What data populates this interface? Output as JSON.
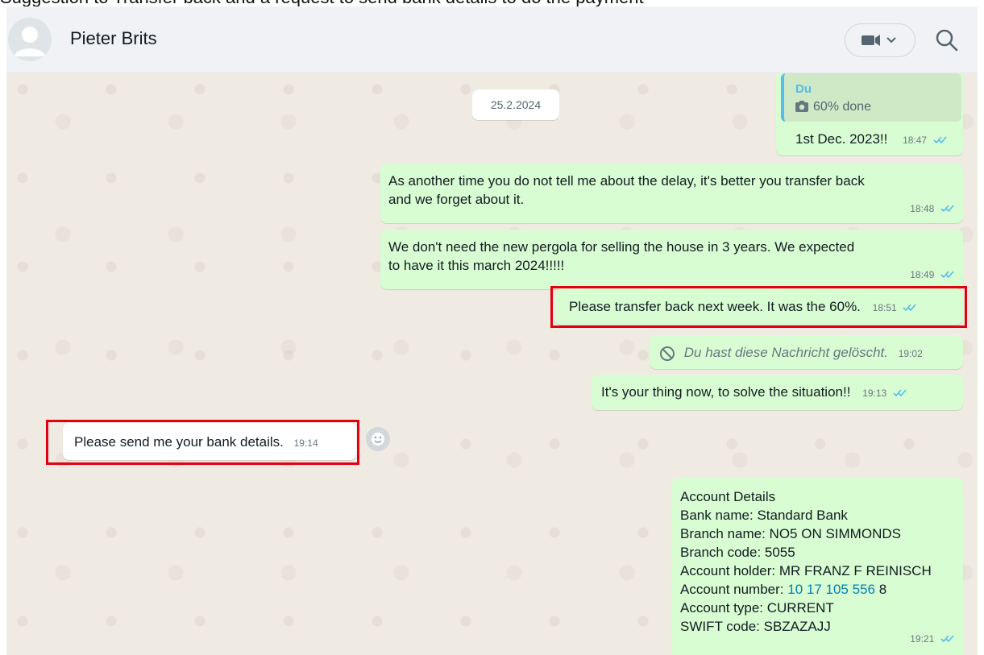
{
  "caption": "Suggestion to Transfer back and a request to send bank details to do the payment",
  "header": {
    "contact_name": "Pieter Brits"
  },
  "date_chip": "25.2.2024",
  "messages": [
    {
      "quote_author": "Du",
      "quote_text": "60% done",
      "text": "1st Dec. 2023!!",
      "time": "18:47"
    },
    {
      "text_line1": "As another time you do not tell me about the delay, it's  better you transfer back",
      "text_line2": "and we forget about it.",
      "time": "18:48"
    },
    {
      "text_line1": "We don't  need the new  pergola for selling the house in 3 years. We expected",
      "text_line2": "to have it this march 2024!!!!!",
      "time": "18:49"
    },
    {
      "text": "Please transfer back next week. It was the 60%.",
      "time": "18:51"
    },
    {
      "text": "Du hast diese Nachricht gelöscht.",
      "time": "19:02"
    },
    {
      "text": "It's your thing now, to solve the situation!!",
      "time": "19:13"
    },
    {
      "text": "Please send me your bank details.",
      "time": "19:14"
    },
    {
      "lines": [
        "Account Details",
        "Bank name: Standard Bank",
        "Branch name: NO5 ON SIMMONDS",
        "Branch code: 5055",
        "Account holder: MR FRANZ F REINISCH"
      ],
      "account_number_label": "Account number: ",
      "account_number_link": "10 17 105 556",
      "account_number_rest": " 8",
      "account_type": "Account type: CURRENT",
      "swift": "SWIFT code: SBZAZAJJ",
      "time": "19:21"
    }
  ],
  "colors": {
    "outgoing_bubble": "#d9fdd3",
    "incoming_bubble": "#ffffff",
    "read_ticks": "#53bdeb",
    "highlight_box": "#e3000f"
  }
}
